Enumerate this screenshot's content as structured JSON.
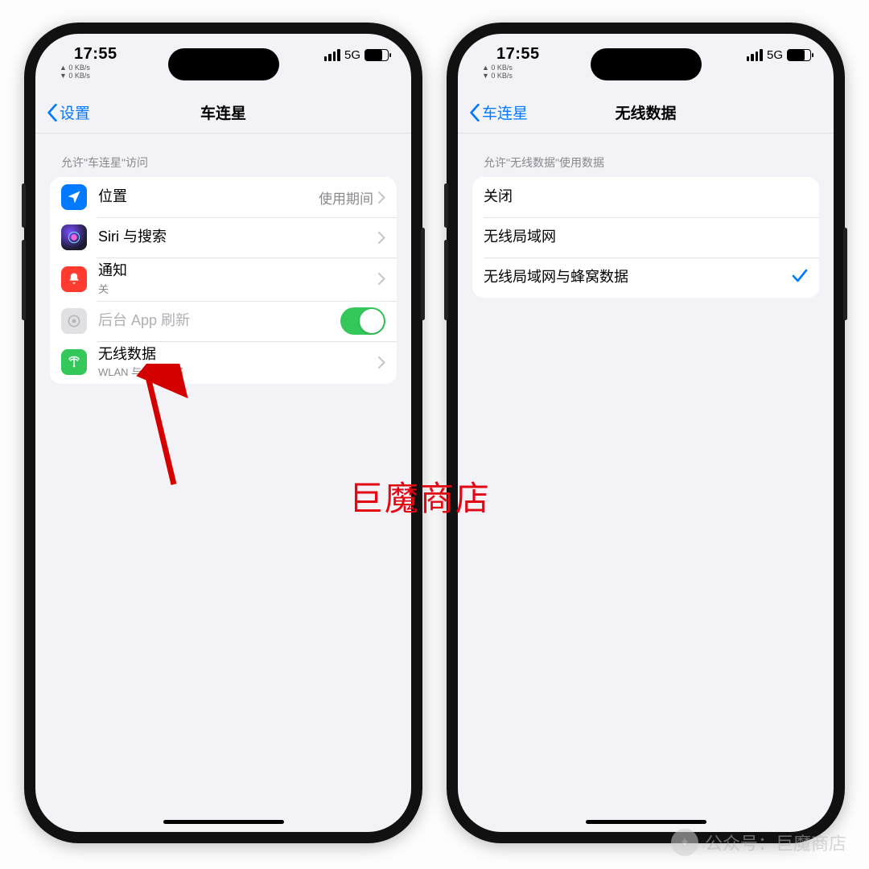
{
  "status": {
    "time": "17:55",
    "up_kbs": "▲ 0 KB/s",
    "down_kbs": "▼ 0 KB/s",
    "network": "5G"
  },
  "phone1": {
    "back_label": "设置",
    "title": "车连星",
    "section_header": "允许\"车连星\"访问",
    "rows": {
      "location": {
        "label": "位置",
        "value": "使用期间"
      },
      "siri": {
        "label": "Siri 与搜索"
      },
      "notif": {
        "label": "通知",
        "sub": "关"
      },
      "refresh": {
        "label": "后台 App 刷新"
      },
      "wireless": {
        "label": "无线数据",
        "sub": "WLAN 与蜂窝网络"
      }
    }
  },
  "phone2": {
    "back_label": "车连星",
    "title": "无线数据",
    "section_header": "允许\"无线数据\"使用数据",
    "options": {
      "off": "关闭",
      "wlan": "无线局域网",
      "both": "无线局域网与蜂窝数据"
    }
  },
  "watermark": "巨魔商店",
  "bottom_watermark": "公众号：巨魔商店"
}
